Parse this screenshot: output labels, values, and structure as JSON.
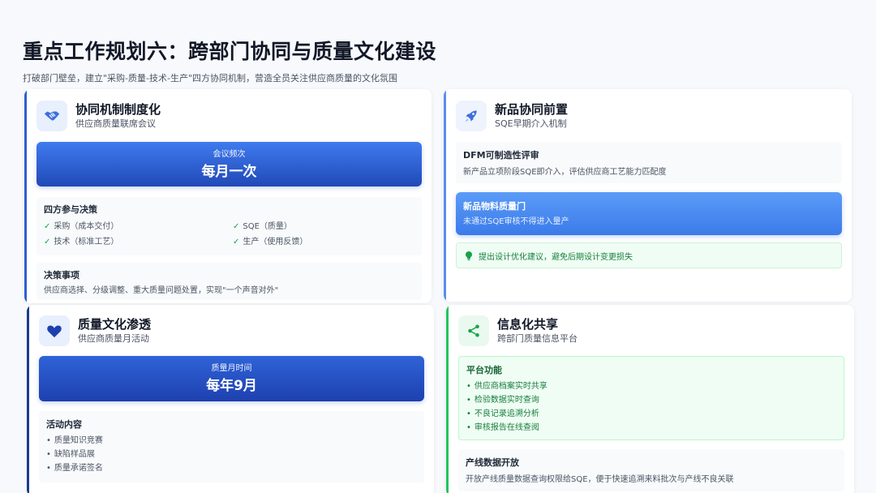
{
  "page": {
    "title": "重点工作规划六：跨部门协同与质量文化建设",
    "subtitle": "打破部门壁垒，建立\"采购-质量-技术-生产\"四方协同机制，营造全员关注供应商质量的文化氛围"
  },
  "colors": {
    "accent_blue": "#2c5fd0",
    "accent_green": "#22c55e",
    "accent_light_blue": "#5b8def"
  },
  "cards": {
    "mechanism": {
      "icon": "handshake-icon",
      "title": "协同机制制度化",
      "subtitle": "供应商质量联席会议",
      "banner_label": "会议频次",
      "banner_value": "每月一次",
      "participants_title": "四方参与决策",
      "participants": [
        "采购（成本交付）",
        "SQE（质量）",
        "技术（标准工艺）",
        "生产（使用反馈）"
      ],
      "decisions_title": "决策事项",
      "decisions_text": "供应商选择、分级调整、重大质量问题处置，实现\"一个声音对外\""
    },
    "new_product": {
      "icon": "rocket-icon",
      "title": "新品协同前置",
      "subtitle": "SQE早期介入机制",
      "dfm_title": "DFM可制造性评审",
      "dfm_text": "新产品立项阶段SQE即介入，评估供应商工艺能力匹配度",
      "gate_title": "新品物料质量门",
      "gate_text": "未通过SQE审核不得进入量产",
      "tip_icon": "lightbulb-icon",
      "tip_text": "提出设计优化建议，避免后期设计变更损失"
    },
    "culture": {
      "icon": "heart-icon",
      "title": "质量文化渗透",
      "subtitle": "供应商质量月活动",
      "banner_label": "质量月时间",
      "banner_value": "每年9月",
      "activities_title": "活动内容",
      "activities": [
        "质量知识竞赛",
        "缺陷样品展",
        "质量承诺签名"
      ]
    },
    "info": {
      "icon": "share-icon",
      "title": "信息化共享",
      "subtitle": "跨部门质量信息平台",
      "features_title": "平台功能",
      "features": [
        "供应商档案实时共享",
        "检验数据实时查询",
        "不良记录追溯分析",
        "审核报告在线查阅"
      ],
      "data_title": "产线数据开放",
      "data_text": "开放产线质量数据查询权限给SQE，便于快速追溯来料批次与产线不良关联"
    }
  }
}
